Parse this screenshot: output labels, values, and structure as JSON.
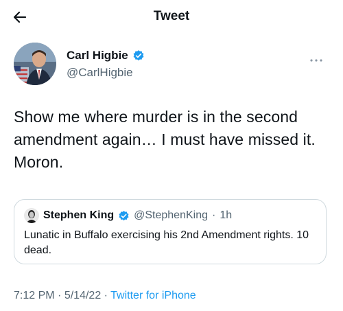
{
  "header": {
    "title": "Tweet",
    "back_icon": "arrow-left-icon"
  },
  "tweet": {
    "author_name": "Carl Higbie",
    "author_handle": "@CarlHigbie",
    "verified": true,
    "text": "Show me where murder is in the second amendment again… I must have missed it. Moron.",
    "time": "7:12 PM",
    "date": "5/14/22",
    "separator": "·",
    "source": "Twitter for iPhone"
  },
  "quoted": {
    "author_name": "Stephen King",
    "author_handle": "@StephenKing",
    "separator": "·",
    "time": "1h",
    "verified": true,
    "text": "Lunatic in Buffalo exercising his 2nd Amendment rights. 10 dead."
  },
  "colors": {
    "accent": "#1d9bf0",
    "secondary_text": "#536471",
    "border": "#cfd9de"
  }
}
